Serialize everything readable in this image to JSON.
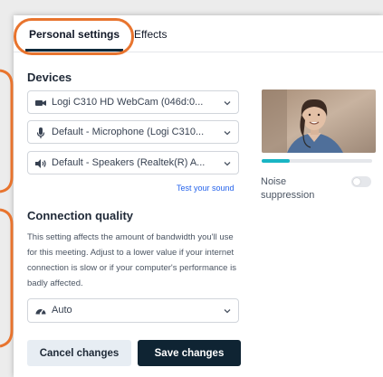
{
  "tabs": [
    {
      "label": "Personal settings",
      "active": true
    },
    {
      "label": "Effects",
      "active": false
    }
  ],
  "devices": {
    "title": "Devices",
    "camera": {
      "value": "Logi C310 HD WebCam (046d:0...",
      "icon": "video-camera-icon"
    },
    "microphone": {
      "value": "Default - Microphone (Logi C310...",
      "icon": "microphone-icon"
    },
    "speakers": {
      "value": "Default - Speakers (Realtek(R) A...",
      "icon": "speaker-icon"
    },
    "test_sound": "Test your sound"
  },
  "preview": {
    "audio_level": 0.25,
    "noise_suppression_label": "Noise suppression",
    "noise_suppression_on": false
  },
  "connection": {
    "title": "Connection quality",
    "description": "This setting affects the amount of bandwidth you'll use for this meeting. Adjust to a lower value if your internet connection is slow or if your computer's performance is badly affected.",
    "quality": {
      "value": "Auto",
      "icon": "speedometer-icon"
    }
  },
  "buttons": {
    "cancel": "Cancel changes",
    "save": "Save changes"
  },
  "colors": {
    "accent": "#0f2433",
    "annotation": "#e8742e",
    "link": "#2563eb",
    "meter": "#19b5c4"
  }
}
